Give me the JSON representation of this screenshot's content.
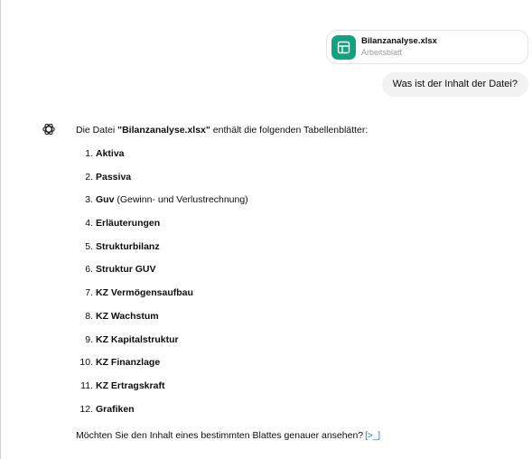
{
  "attachment": {
    "filename": "Bilanzanalyse.xlsx",
    "type": "Arbeitsblatt",
    "icon": "spreadsheet-icon",
    "icon_color": "#10a37f"
  },
  "user_message": "Was ist der Inhalt der Datei?",
  "assistant": {
    "avatar_icon": "openai-logo-icon",
    "intro_prefix": "Die Datei ",
    "intro_filename": "\"Bilanzanalyse.xlsx\"",
    "intro_suffix": " enthält die folgenden Tabellenblätter:",
    "sheets": [
      {
        "num": "1.",
        "name": "Aktiva",
        "desc": ""
      },
      {
        "num": "2.",
        "name": "Passiva",
        "desc": ""
      },
      {
        "num": "3.",
        "name": "Guv",
        "desc": " (Gewinn- und Verlustrechnung)"
      },
      {
        "num": "4.",
        "name": "Erläuterungen",
        "desc": ""
      },
      {
        "num": "5.",
        "name": "Strukturbilanz",
        "desc": ""
      },
      {
        "num": "6.",
        "name": "Struktur GUV",
        "desc": ""
      },
      {
        "num": "7.",
        "name": "KZ Vermögensaufbau",
        "desc": ""
      },
      {
        "num": "8.",
        "name": "KZ Wachstum",
        "desc": ""
      },
      {
        "num": "9.",
        "name": "KZ Kapitalstruktur",
        "desc": ""
      },
      {
        "num": "10.",
        "name": "KZ Finanzlage",
        "desc": ""
      },
      {
        "num": "11.",
        "name": "KZ Ertragskraft",
        "desc": ""
      },
      {
        "num": "12.",
        "name": "Grafiken",
        "desc": ""
      }
    ],
    "outro": "Möchten Sie den Inhalt eines bestimmten Blattes genauer ansehen?",
    "code_link_icon": "code-analysis-icon",
    "code_link_glyph": "[>_]"
  }
}
